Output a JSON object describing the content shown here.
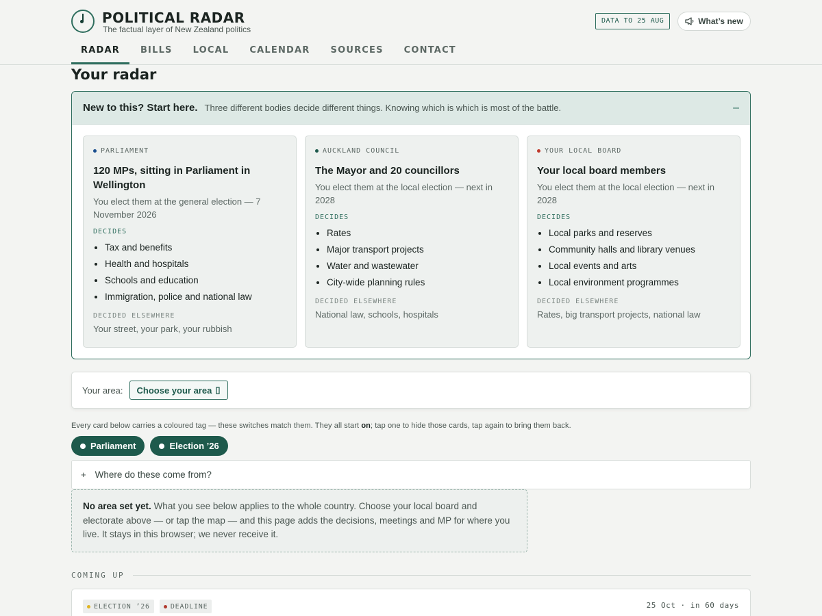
{
  "header": {
    "brand": "POLITICAL RADAR",
    "tagline": "The factual layer of New Zealand politics",
    "data_badge": "DATA TO 25 AUG",
    "whats_new": "What’s new",
    "nav": [
      {
        "label": "RADAR",
        "active": true
      },
      {
        "label": "BILLS"
      },
      {
        "label": "LOCAL"
      },
      {
        "label": "CALENDAR"
      },
      {
        "label": "SOURCES"
      },
      {
        "label": "CONTACT"
      }
    ]
  },
  "page_title": "Your radar",
  "explainer": {
    "title": "New to this? Start here.",
    "subtitle": "Three different bodies decide different things. Knowing which is which is most of the battle.",
    "collapse_icon": "–",
    "cards": [
      {
        "tag": "PARLIAMENT",
        "tag_color": "#1a4f8f",
        "title": "120 MPs, sitting in Parliament in Wellington",
        "desc": "You elect them at the general election — 7 November 2026",
        "decides_label": "DECIDES",
        "decides": [
          "Tax and benefits",
          "Health and hospitals",
          "Schools and education",
          "Immigration, police and national law"
        ],
        "elsewhere_label": "DECIDED ELSEWHERE",
        "elsewhere": "Your street, your park, your rubbish"
      },
      {
        "tag": "AUCKLAND COUNCIL",
        "tag_color": "#1e5a4c",
        "title": "The Mayor and 20 councillors",
        "desc": "You elect them at the local election — next in 2028",
        "decides_label": "DECIDES",
        "decides": [
          "Rates",
          "Major transport projects",
          "Water and wastewater",
          "City-wide planning rules"
        ],
        "elsewhere_label": "DECIDED ELSEWHERE",
        "elsewhere": "National law, schools, hospitals"
      },
      {
        "tag": "YOUR LOCAL BOARD",
        "tag_color": "#c0392b",
        "title": "Your local board members",
        "desc": "You elect them at the local election — next in 2028",
        "decides_label": "DECIDES",
        "decides": [
          "Local parks and reserves",
          "Community halls and library venues",
          "Local events and arts",
          "Local environment programmes"
        ],
        "elsewhere_label": "DECIDED ELSEWHERE",
        "elsewhere": "Rates, big transport projects, national law"
      }
    ]
  },
  "area": {
    "label": "Your area:",
    "button": "Choose your area",
    "button_icon": "▯"
  },
  "filters": {
    "help_before": "Every card below carries a coloured tag — these switches match them. They all start ",
    "help_bold": "on",
    "help_after": "; tap one to hide those cards, tap again to bring them back.",
    "pills": [
      "Parliament",
      "Election ’26"
    ]
  },
  "sources_toggle": {
    "icon": "+",
    "label": "Where do these come from?"
  },
  "notice": {
    "bold": "No area set yet.",
    "text": " What you see below applies to the whole country. Choose your local board and electorate above — or tap the map — and this page adds the decisions, meetings and MP for where you live. It stays in this browser; we never receive it."
  },
  "coming_up": {
    "label": "COMING UP",
    "event": {
      "tags": [
        {
          "label": "ELECTION ’26",
          "color": "#e0b422"
        },
        {
          "label": "DEADLINE",
          "color": "#b03a2e"
        }
      ],
      "date": "25 Oct · in 60 days"
    }
  }
}
